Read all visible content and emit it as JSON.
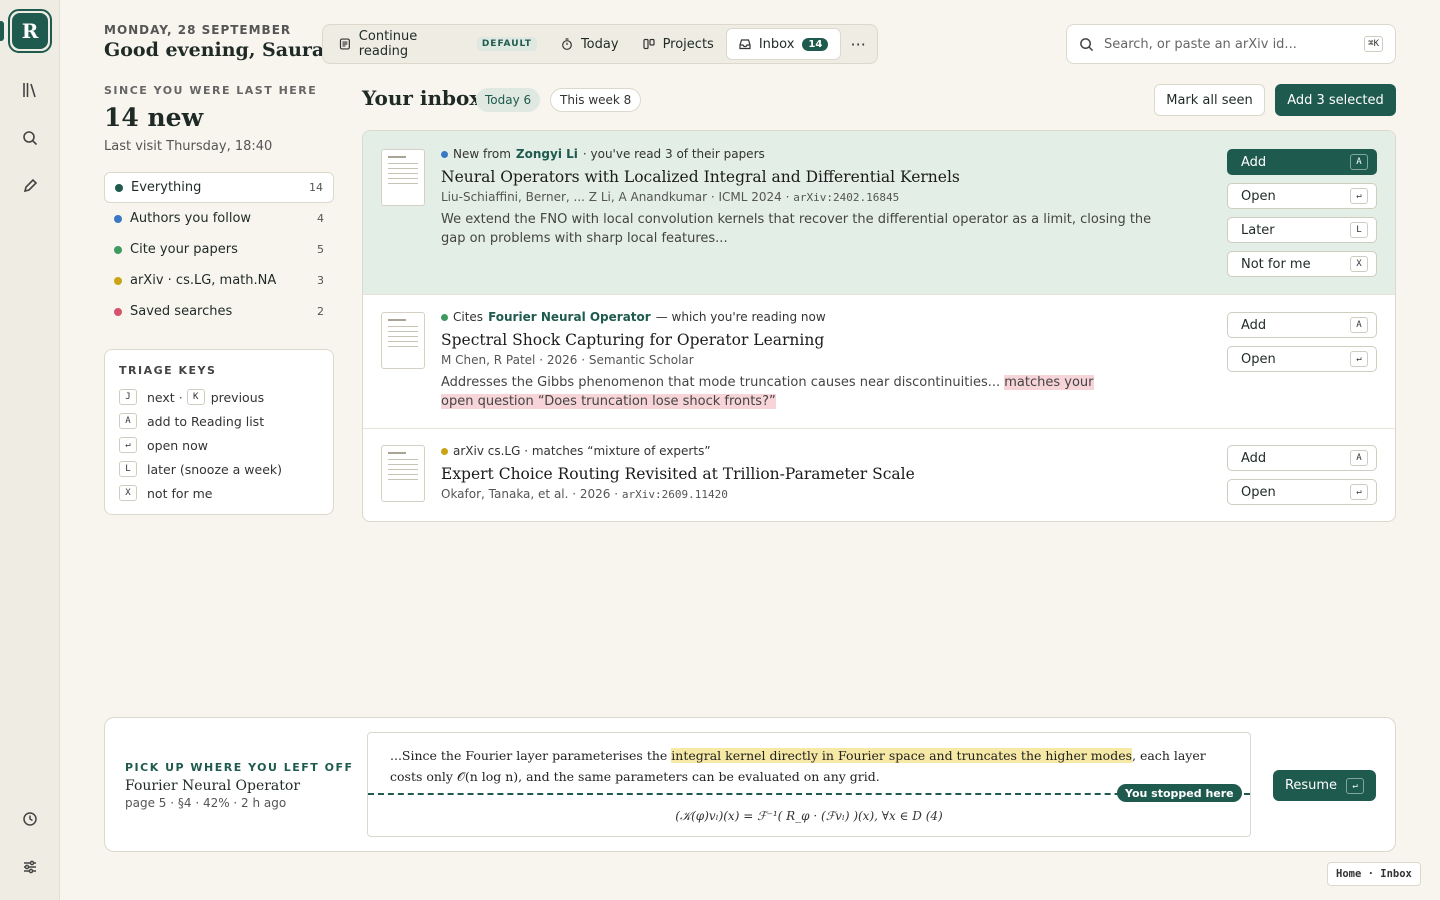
{
  "rail": {
    "logo_letter": "R",
    "icons": [
      "library-icon",
      "search-icon",
      "pen-icon",
      "clock-icon",
      "sliders-icon"
    ]
  },
  "header": {
    "date": "MONDAY, 28 SEPTEMBER",
    "greeting": "Good evening, Saurav"
  },
  "summary": {
    "since_label": "SINCE YOU WERE LAST HERE",
    "new_count": "14 new",
    "last_visit": "Last visit Thursday, 18:40"
  },
  "filters": [
    {
      "label": "Everything",
      "count": "14",
      "color": "#1f5a4e"
    },
    {
      "label": "Authors you follow",
      "count": "4",
      "color": "#3a77c4"
    },
    {
      "label": "Cite your papers",
      "count": "5",
      "color": "#3f9a62"
    },
    {
      "label": "arXiv · cs.LG, math.NA",
      "count": "3",
      "color": "#c9a417"
    },
    {
      "label": "Saved searches",
      "count": "2",
      "color": "#d3546c"
    }
  ],
  "triage": {
    "title": "TRIAGE KEYS",
    "next_key": "J",
    "next_label": "next",
    "mid": "·",
    "prev_key": "K",
    "prev_label": "previous",
    "rows": [
      {
        "key": "A",
        "label": "add to Reading list"
      },
      {
        "key": "↵",
        "label": "open now"
      },
      {
        "key": "L",
        "label": "later (snooze a week)"
      },
      {
        "key": "X",
        "label": "not for me"
      }
    ]
  },
  "nav": {
    "continue_label": "Continue reading",
    "continue_badge": "DEFAULT",
    "today_label": "Today",
    "projects_label": "Projects",
    "inbox_label": "Inbox",
    "inbox_count": "14",
    "more_label": "···"
  },
  "search": {
    "placeholder": "Search, or paste an arXiv id...",
    "shortcut": "⌘K"
  },
  "inbox": {
    "title": "Your inbox",
    "today_pill": "Today 6",
    "week_pill": "This week 8",
    "mark_seen": "Mark all seen",
    "add_selected": "Add 3 selected"
  },
  "items": [
    {
      "dot_color": "#3a77c4",
      "meta_prefix": "New from",
      "meta_bold": "Zongyi Li",
      "meta_suffix": "· you've read 3 of their papers",
      "title": "Neural Operators with Localized Integral and Differential Kernels",
      "authors": "Liu-Schiaffini, Berner, ... Z Li, A Anandkumar · ICML 2024 ·",
      "arxiv": "arXiv:2402.16845",
      "abstract": "We extend the FNO with local convolution kernels that recover the differential operator as a limit, closing the gap on problems with sharp local features...",
      "actions": [
        {
          "label": "Add",
          "key": "A"
        },
        {
          "label": "Open",
          "key": "↵"
        },
        {
          "label": "Later",
          "key": "L"
        },
        {
          "label": "Not for me",
          "key": "X"
        }
      ]
    },
    {
      "dot_color": "#3f9a62",
      "meta_prefix": "Cites",
      "meta_bold": "Fourier Neural Operator",
      "meta_suffix": "— which you're reading now",
      "title": "Spectral Shock Capturing for Operator Learning",
      "authors": "M Chen, R Patel · 2026 · Semantic Scholar",
      "abstract_plain": "Addresses the Gibbs phenomenon that mode truncation causes near discontinuities... ",
      "abstract_hl": "matches your open question “Does truncation lose shock fronts?”",
      "actions": [
        {
          "label": "Add",
          "key": "A"
        },
        {
          "label": "Open",
          "key": "↵"
        }
      ]
    },
    {
      "dot_color": "#c9a417",
      "meta_prefix": "arXiv cs.LG · matches “mixture of experts”",
      "title": "Expert Choice Routing Revisited at Trillion-Parameter Scale",
      "authors": "Okafor, Tanaka, et al. · 2026 ·",
      "arxiv": "arXiv:2609.11420",
      "actions": [
        {
          "label": "Add",
          "key": "A"
        },
        {
          "label": "Open",
          "key": "↵"
        }
      ]
    }
  ],
  "resume": {
    "label": "PICK UP WHERE YOU LEFT OFF",
    "paper_title": "Fourier Neural Operator",
    "meta": "page 5 · §4 · 42% · 2 h ago",
    "progress_percent": 42,
    "excerpt_before": "...Since the Fourier layer parameterises the ",
    "excerpt_hl": "integral kernel directly in Fourier space and truncates the higher modes",
    "excerpt_after": ", each layer costs only 𝒪(n log n), and the same parameters can be evaluated on any grid.",
    "stop_label": "You stopped here",
    "formula": "(𝒦(φ)vₗ)(x) = ℱ⁻¹( R_φ · (ℱvₗ) )(x),  ∀x ∈ D   (4)",
    "button": "Resume",
    "button_key": "↵"
  },
  "breadcrumb": "Home · Inbox"
}
